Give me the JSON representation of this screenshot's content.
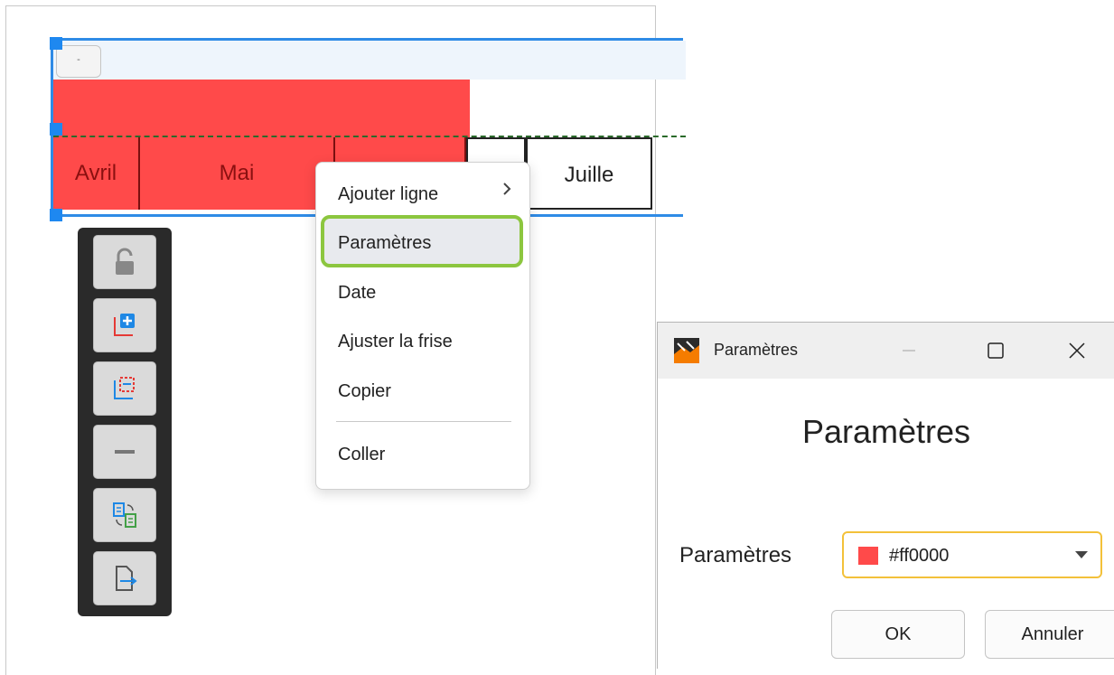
{
  "timeline": {
    "mini_button_label": "-",
    "months": [
      "Avril",
      "Mai",
      "",
      "",
      "Juille"
    ]
  },
  "toolbar": {
    "tools": [
      "lock-icon",
      "add-row-icon",
      "select-range-icon",
      "remove-icon",
      "swap-docs-icon",
      "insert-doc-icon"
    ]
  },
  "context_menu": {
    "items": [
      "Ajouter ligne",
      "Paramètres",
      "Date",
      "Ajuster la frise",
      "Copier",
      "Coller"
    ],
    "highlight_color": "#8cc63f"
  },
  "dialog": {
    "window_title": "Paramètres",
    "heading": "Paramètres",
    "field_label": "Paramètres",
    "color_value": "#ff0000",
    "ok_label": "OK",
    "cancel_label": "Annuler"
  },
  "colors": {
    "accent": "#2f8be6",
    "bar_red": "#ff4a4a",
    "combo_border": "#f3c13a"
  }
}
